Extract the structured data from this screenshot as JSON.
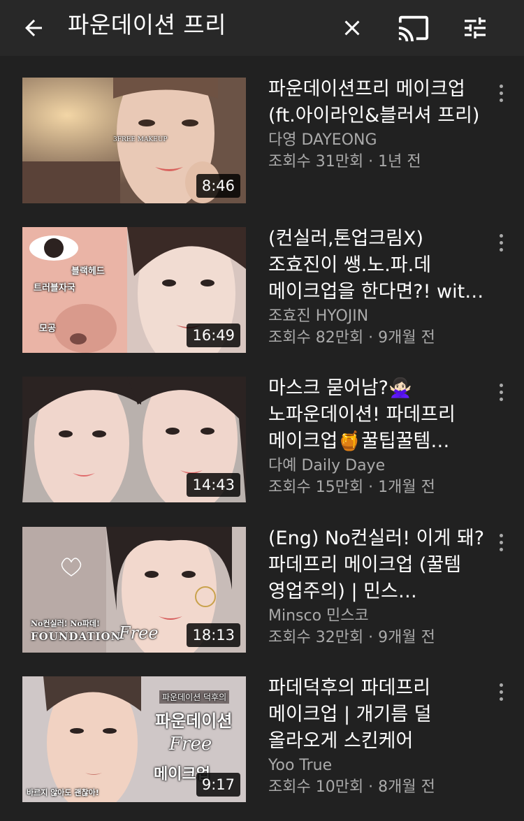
{
  "search": {
    "query": "파운데이션 프리"
  },
  "icons": {
    "back": "arrow-back-icon",
    "clear": "close-icon",
    "cast": "cast-icon",
    "filter": "filter-sliders-icon",
    "more": "more-vert-icon"
  },
  "colors": {
    "background": "#212121",
    "topbar": "#282828",
    "secondary_text": "#aaaaaa"
  },
  "videos": [
    {
      "title": "파운데이션프리 메이크업 (ft.아이라인&블러셔 프리)",
      "channel": "다영 DAYEONG",
      "stats": "조회수 31만회 · 1년 전",
      "duration": "8:46",
      "thumb_text": [
        "3FREE MAKEUP"
      ]
    },
    {
      "title": "(컨실러,톤업크림X) 조효진이 쌩.노.파.데 메이크업을 한다면?! with.모…",
      "channel": "조효진 HYOJIN",
      "stats": "조회수 82만회 · 9개월 전",
      "duration": "16:49",
      "thumb_text": [
        "블랙헤드",
        "트러블자국",
        "모공"
      ]
    },
    {
      "title": "마스크 묻어남?🙅🏻‍♀️노파운데이션! 파데프리 메이크업🍯꿀팁꿀템 (+N…",
      "channel": "다예 Daily Daye",
      "stats": "조회수 15만회 · 1개월 전",
      "duration": "14:43",
      "thumb_text": []
    },
    {
      "title": "(Eng) No컨실러! 이게 돼? 파데프리 메이크업 (꿀템 영업주의) | 민스…",
      "channel": "Minsco 민스코",
      "stats": "조회수 32만회 · 9개월 전",
      "duration": "18:13",
      "thumb_text": [
        "No컨실러! No파데!",
        "FOUNDATION",
        "Free"
      ]
    },
    {
      "title": "파데덕후의 파데프리 메이크업 | 개기름 덜 올라오게 스킨케어",
      "channel": "Yoo True",
      "stats": "조회수 10만회 · 8개월 전",
      "duration": "9:17",
      "thumb_text": [
        "파운데이션 덕후의",
        "파운데이션",
        "Free",
        "메이크업",
        "바르지 않아도 괜찮아!"
      ]
    }
  ]
}
